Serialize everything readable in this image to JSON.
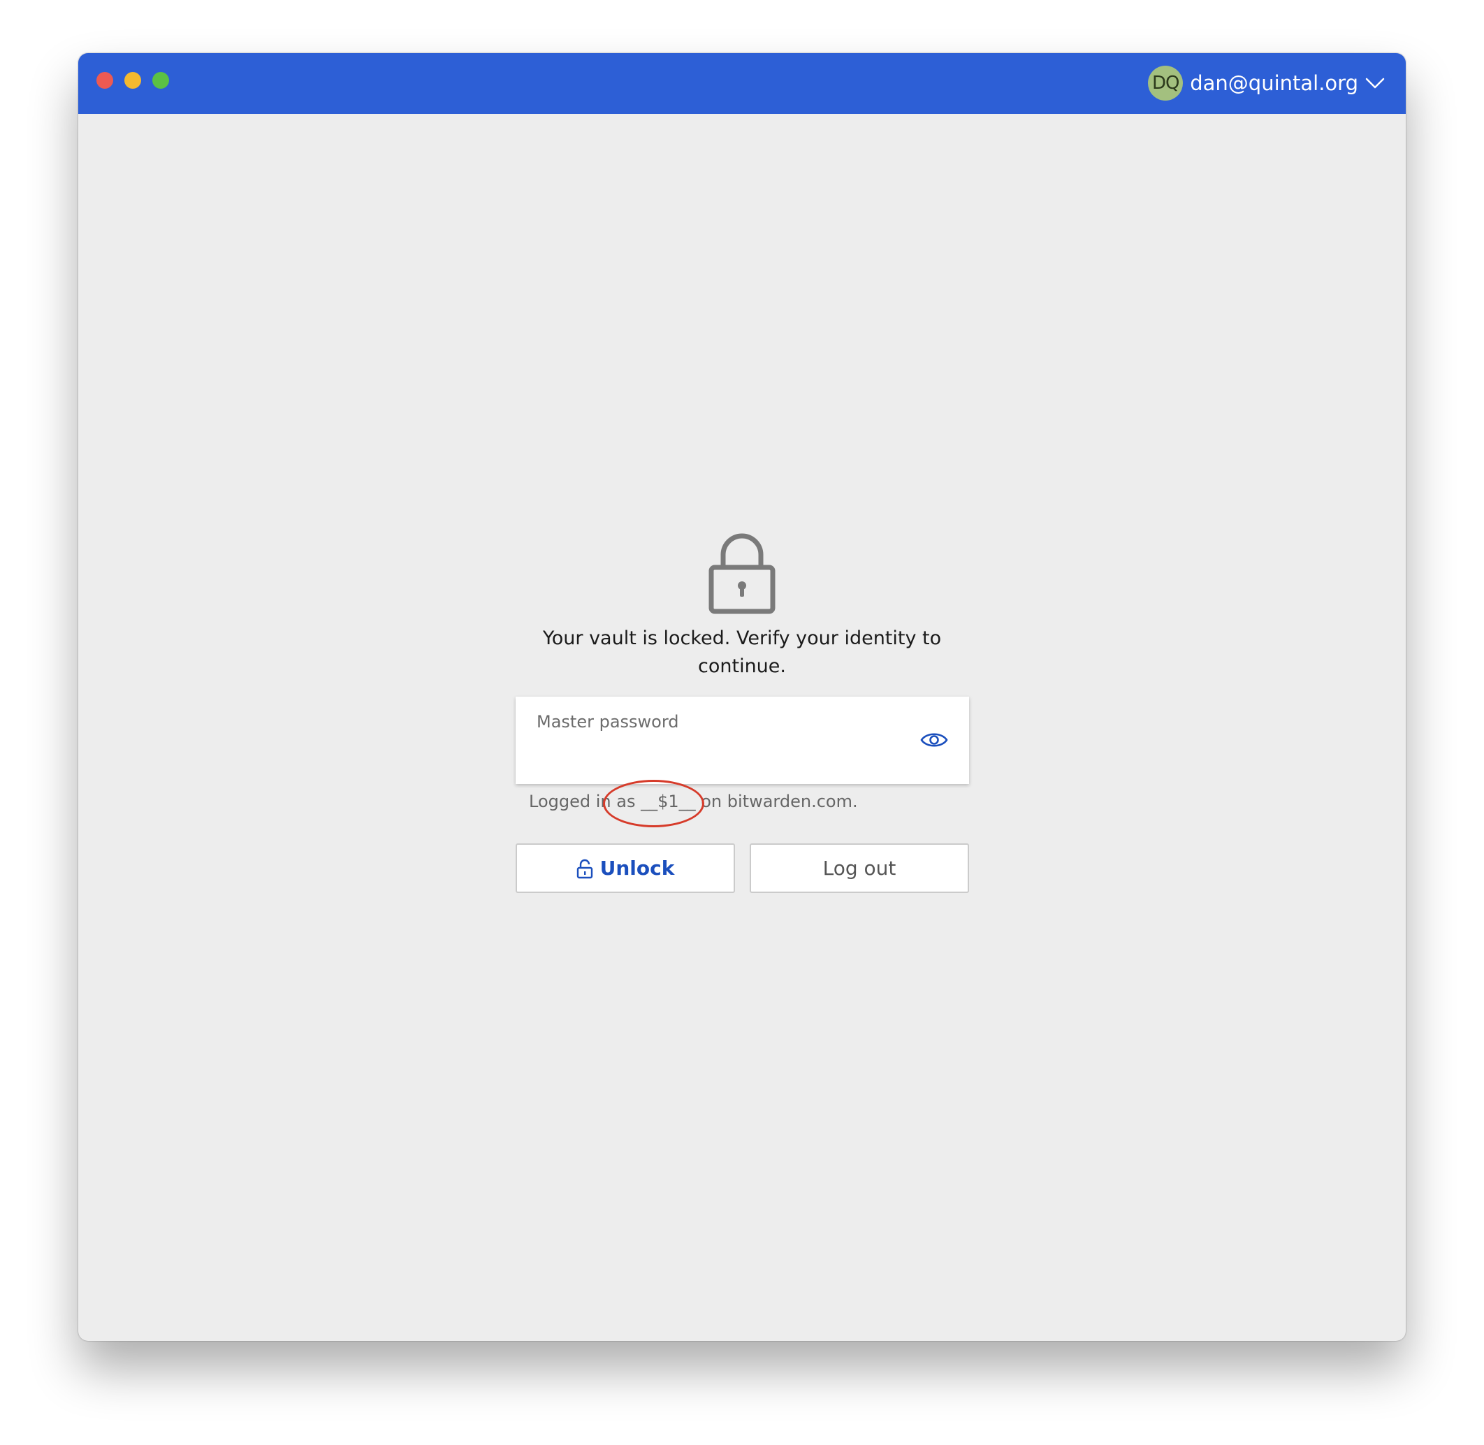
{
  "account": {
    "initials": "DQ",
    "email": "dan@quintal.org"
  },
  "lock": {
    "message": "Your vault is locked. Verify your identity to continue."
  },
  "password": {
    "label": "Master password",
    "value": ""
  },
  "logged_in_text": "Logged in as __$1__ on bitwarden.com.",
  "buttons": {
    "unlock": "Unlock",
    "logout": "Log out"
  },
  "colors": {
    "titlebar": "#2d5fd6",
    "accent": "#1b4fbd",
    "annotation": "#d63b2a"
  },
  "icons": {
    "lock": "lock-icon",
    "eye": "eye-icon",
    "unlock": "unlock-icon",
    "chevron": "chevron-down-icon"
  }
}
